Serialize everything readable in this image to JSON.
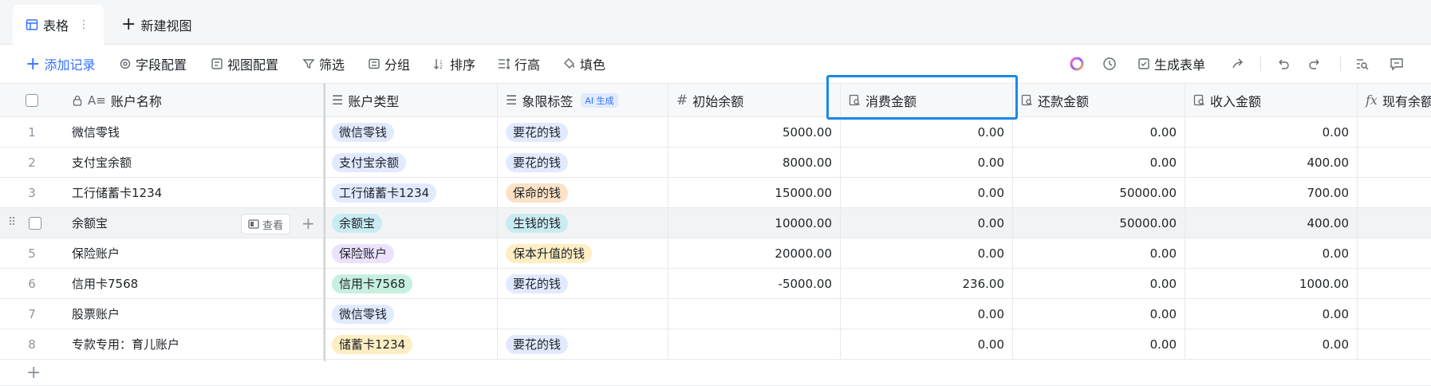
{
  "tabs": {
    "active_label": "表格",
    "new_view_label": "新建视图"
  },
  "toolbar": {
    "add_record": "添加记录",
    "field_config": "字段配置",
    "view_config": "视图配置",
    "filter": "筛选",
    "group": "分组",
    "sort": "排序",
    "row_height": "行高",
    "fill_color": "填色",
    "generate_form": "生成表单"
  },
  "columns": {
    "account_name": "账户名称",
    "account_type": "账户类型",
    "quadrant_tag": "象限标签",
    "ai_badge": "AI 生成",
    "initial_balance": "初始余额",
    "spend_amount": "消费金额",
    "repay_amount": "还款金额",
    "income_amount": "收入金额",
    "current_balance": "现有余额"
  },
  "row_actions": {
    "view_label": "查看"
  },
  "rows": [
    {
      "num": "1",
      "name": "微信零钱",
      "type": "微信零钱",
      "type_color": "#e1eaff",
      "tag": "要花的钱",
      "tag_color": "#e1eaff",
      "initial": "5000.00",
      "spend": "0.00",
      "repay": "0.00",
      "income": "0.00"
    },
    {
      "num": "2",
      "name": "支付宝余额",
      "type": "支付宝余额",
      "type_color": "#e1eaff",
      "tag": "要花的钱",
      "tag_color": "#e1eaff",
      "initial": "8000.00",
      "spend": "0.00",
      "repay": "0.00",
      "income": "400.00"
    },
    {
      "num": "3",
      "name": "工行储蓄卡1234",
      "type": "工行储蓄卡1234",
      "type_color": "#e1eaff",
      "tag": "保命的钱",
      "tag_color": "#fde2c6",
      "initial": "15000.00",
      "spend": "0.00",
      "repay": "50000.00",
      "income": "700.00"
    },
    {
      "num": "",
      "name": "余额宝",
      "type": "余额宝",
      "type_color": "#c9ebf2",
      "tag": "生钱的钱",
      "tag_color": "#c9ebf2",
      "initial": "10000.00",
      "spend": "0.00",
      "repay": "50000.00",
      "income": "400.00"
    },
    {
      "num": "5",
      "name": "保险账户",
      "type": "保险账户",
      "type_color": "#ece2fe",
      "tag": "保本升值的钱",
      "tag_color": "#fdeec3",
      "initial": "20000.00",
      "spend": "0.00",
      "repay": "0.00",
      "income": "0.00"
    },
    {
      "num": "6",
      "name": "信用卡7568",
      "type": "信用卡7568",
      "type_color": "#c7f0e0",
      "tag": "要花的钱",
      "tag_color": "#e1eaff",
      "initial": "-5000.00",
      "spend": "236.00",
      "repay": "0.00",
      "income": "1000.00"
    },
    {
      "num": "7",
      "name": "股票账户",
      "type": "微信零钱",
      "type_color": "#e1eaff",
      "tag": "",
      "tag_color": "",
      "initial": "",
      "spend": "0.00",
      "repay": "0.00",
      "income": "0.00"
    },
    {
      "num": "8",
      "name": "专款专用：育儿账户",
      "type": "储蓄卡1234",
      "type_color": "#fdeec3",
      "tag": "要花的钱",
      "tag_color": "#e1eaff",
      "initial": "",
      "spend": "0.00",
      "repay": "0.00",
      "income": "0.00"
    }
  ]
}
